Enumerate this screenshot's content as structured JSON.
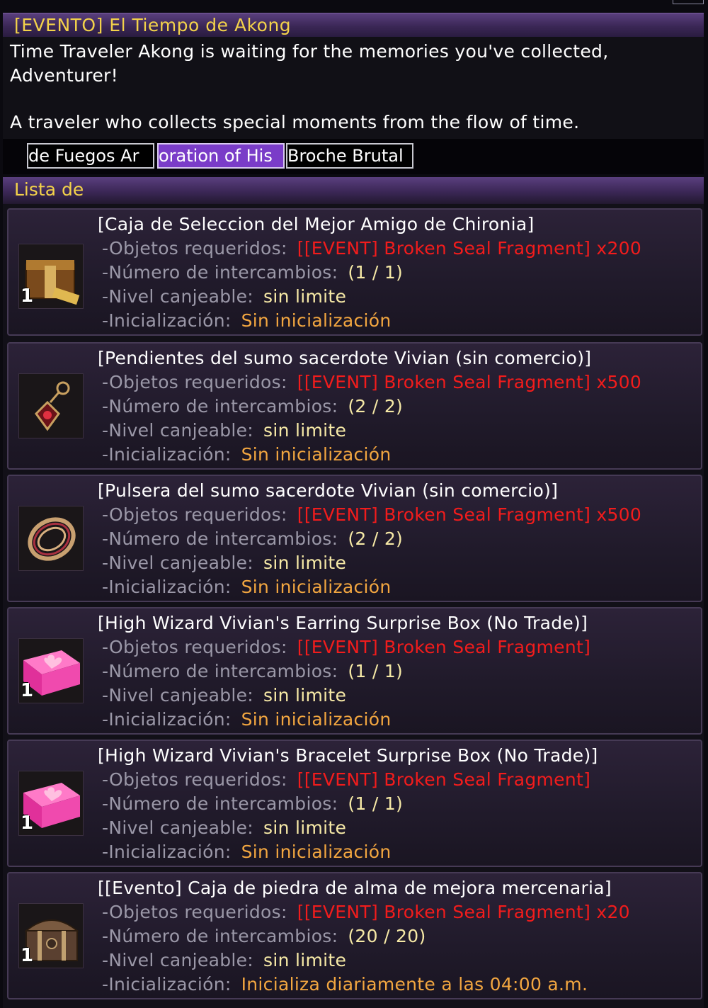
{
  "window": {
    "title": "[EVENTO] El Tiempo de Akong"
  },
  "description": {
    "line1": "Time Traveler Akong is waiting for the memories you've collected,",
    "line2": "Adventurer!",
    "line3": "A traveler who collects special moments from the flow of time."
  },
  "tabs": [
    {
      "label": "de Fuegos Ar"
    },
    {
      "label": "oration of His"
    },
    {
      "label": "Broche Brutal"
    }
  ],
  "list": {
    "header": "Lista de",
    "labels": {
      "required": "-Objetos requeridos:",
      "exchanges": "-Número de intercambios:",
      "level": "-Nivel canjeable:",
      "init": "-Inicialización:"
    },
    "items": [
      {
        "title": "[Caja de Seleccion del Mejor Amigo de Chironia]",
        "required": "[[EVENT] Broken Seal Fragment] x200",
        "exchanges": "(1 / 1)",
        "level": "sin limite",
        "init": "Sin inicialización",
        "qty": "1",
        "icon": "chest-box-icon"
      },
      {
        "title": "[Pendientes del sumo sacerdote Vivian (sin comercio)]",
        "required": "[[EVENT] Broken Seal Fragment] x500",
        "exchanges": "(2 / 2)",
        "level": "sin limite",
        "init": "Sin inicialización",
        "qty": "",
        "icon": "earring-icon"
      },
      {
        "title": "[Pulsera del sumo sacerdote Vivian (sin comercio)]",
        "required": "[[EVENT] Broken Seal Fragment] x500",
        "exchanges": "(2 / 2)",
        "level": "sin limite",
        "init": "Sin inicialización",
        "qty": "",
        "icon": "bracelet-icon"
      },
      {
        "title": "[High Wizard Vivian's Earring Surprise Box (No Trade)]",
        "required": "[[EVENT] Broken Seal Fragment]",
        "exchanges": "(1 / 1)",
        "level": "sin limite",
        "init": "Sin inicialización",
        "qty": "1",
        "icon": "pink-gift-box-icon"
      },
      {
        "title": "[High Wizard Vivian's Bracelet Surprise Box (No Trade)]",
        "required": "[[EVENT] Broken Seal Fragment]",
        "exchanges": "(1 / 1)",
        "level": "sin limite",
        "init": "Sin inicialización",
        "qty": "1",
        "icon": "pink-gift-box-icon"
      },
      {
        "title": "[[Evento] Caja de piedra de alma de mejora mercenaria]",
        "required": "[[EVENT] Broken Seal Fragment] x20",
        "exchanges": "(20 / 20)",
        "level": "sin limite",
        "init": "Inicializa diariamente a las 04:00 a.m.",
        "qty": "1",
        "icon": "treasure-chest-icon"
      }
    ]
  }
}
